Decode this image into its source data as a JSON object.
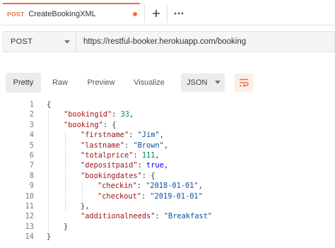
{
  "tab": {
    "method": "POST",
    "title": "CreateBookingXML"
  },
  "tab_actions": {
    "new_tab": "+",
    "more": "•••"
  },
  "request": {
    "method": "POST",
    "url": "https://restful-booker.herokuapp.com/booking"
  },
  "response_toolbar": {
    "views": [
      "Pretty",
      "Raw",
      "Preview",
      "Visualize"
    ],
    "active_view": "Pretty",
    "format": "JSON"
  },
  "body_lines": [
    {
      "n": "1",
      "indent": 0,
      "tokens": [
        {
          "t": "p",
          "v": "{"
        }
      ]
    },
    {
      "n": "2",
      "indent": 1,
      "tokens": [
        {
          "t": "k",
          "v": "\"bookingid\""
        },
        {
          "t": "p",
          "v": ": "
        },
        {
          "t": "n",
          "v": "33"
        },
        {
          "t": "p",
          "v": ","
        }
      ]
    },
    {
      "n": "3",
      "indent": 1,
      "tokens": [
        {
          "t": "k",
          "v": "\"booking\""
        },
        {
          "t": "p",
          "v": ": {"
        }
      ]
    },
    {
      "n": "4",
      "indent": 2,
      "tokens": [
        {
          "t": "k",
          "v": "\"firstname\""
        },
        {
          "t": "p",
          "v": ": "
        },
        {
          "t": "s",
          "v": "\"Jim\""
        },
        {
          "t": "p",
          "v": ","
        }
      ]
    },
    {
      "n": "5",
      "indent": 2,
      "tokens": [
        {
          "t": "k",
          "v": "\"lastname\""
        },
        {
          "t": "p",
          "v": ": "
        },
        {
          "t": "s",
          "v": "\"Brown\""
        },
        {
          "t": "p",
          "v": ","
        }
      ]
    },
    {
      "n": "6",
      "indent": 2,
      "tokens": [
        {
          "t": "k",
          "v": "\"totalprice\""
        },
        {
          "t": "p",
          "v": ": "
        },
        {
          "t": "n",
          "v": "111"
        },
        {
          "t": "p",
          "v": ","
        }
      ]
    },
    {
      "n": "7",
      "indent": 2,
      "tokens": [
        {
          "t": "k",
          "v": "\"depositpaid\""
        },
        {
          "t": "p",
          "v": ": "
        },
        {
          "t": "b",
          "v": "true"
        },
        {
          "t": "p",
          "v": ","
        }
      ]
    },
    {
      "n": "8",
      "indent": 2,
      "tokens": [
        {
          "t": "k",
          "v": "\"bookingdates\""
        },
        {
          "t": "p",
          "v": ": {"
        }
      ]
    },
    {
      "n": "9",
      "indent": 3,
      "tokens": [
        {
          "t": "k",
          "v": "\"checkin\""
        },
        {
          "t": "p",
          "v": ": "
        },
        {
          "t": "s",
          "v": "\"2018-01-01\""
        },
        {
          "t": "p",
          "v": ","
        }
      ]
    },
    {
      "n": "10",
      "indent": 3,
      "tokens": [
        {
          "t": "k",
          "v": "\"checkout\""
        },
        {
          "t": "p",
          "v": ": "
        },
        {
          "t": "s",
          "v": "\"2019-01-01\""
        }
      ]
    },
    {
      "n": "11",
      "indent": 2,
      "tokens": [
        {
          "t": "p",
          "v": "},"
        }
      ]
    },
    {
      "n": "12",
      "indent": 2,
      "tokens": [
        {
          "t": "k",
          "v": "\"additionalneeds\""
        },
        {
          "t": "p",
          "v": ": "
        },
        {
          "t": "s",
          "v": "\"Breakfast\""
        }
      ]
    },
    {
      "n": "13",
      "indent": 1,
      "tokens": [
        {
          "t": "p",
          "v": "}"
        }
      ]
    },
    {
      "n": "14",
      "indent": 0,
      "tokens": [
        {
          "t": "p",
          "v": "}"
        }
      ]
    }
  ],
  "colors": {
    "accent": "#f26b3a",
    "key": "#a31515",
    "string": "#0451a5",
    "number": "#098658",
    "boolean": "#0000ff"
  }
}
